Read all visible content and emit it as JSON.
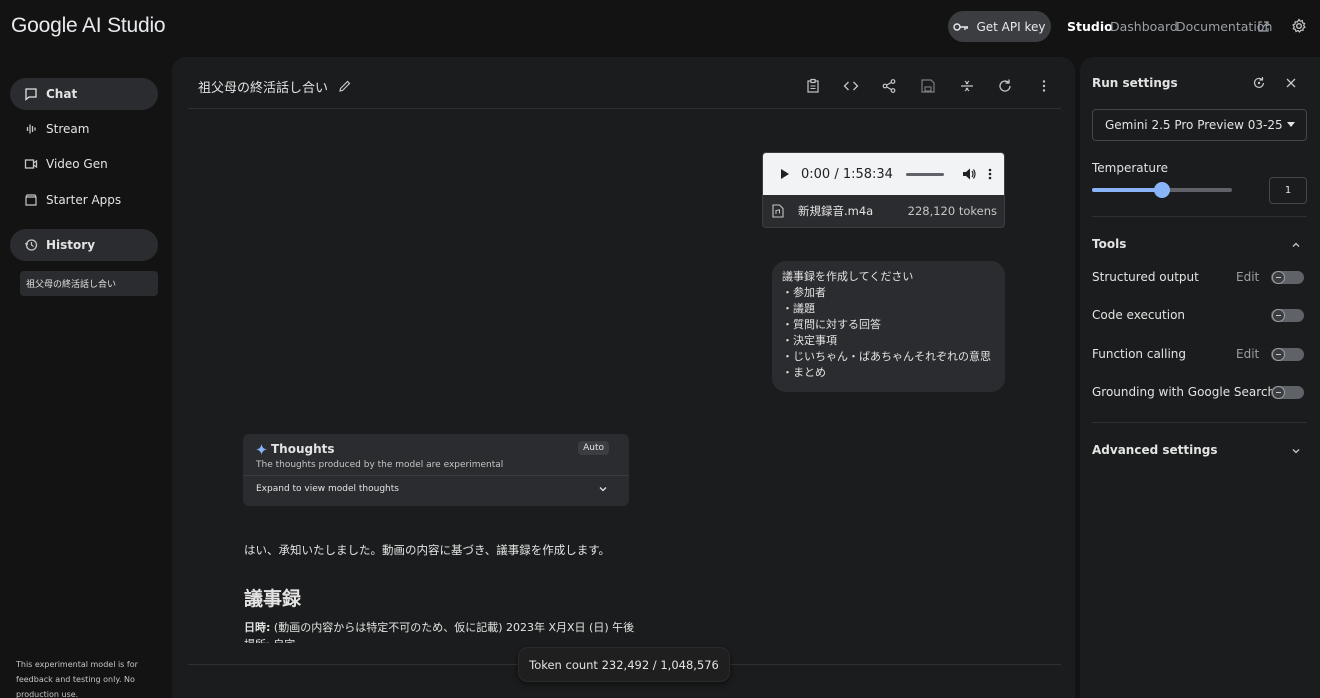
{
  "app": {
    "logo": "Google AI Studio"
  },
  "header": {
    "api_key_label": "Get API key",
    "links": {
      "studio": "Studio",
      "dashboard": "Dashboard",
      "documentation": "Documentation"
    },
    "icons": [
      "key-icon",
      "external-link-icon",
      "gear-icon"
    ]
  },
  "sidebar": {
    "items": [
      {
        "label": "Chat",
        "icon": "chat-icon",
        "active": true
      },
      {
        "label": "Stream",
        "icon": "waveform-icon",
        "active": false
      },
      {
        "label": "Video Gen",
        "icon": "video-icon",
        "active": false
      },
      {
        "label": "Starter Apps",
        "icon": "apps-icon",
        "active": false
      }
    ],
    "history": {
      "label": "History",
      "icon": "history-icon"
    },
    "history_items": [
      "祖父母の終活話し合い"
    ],
    "disclaimer": "This experimental model is for feedback and testing only. No production use."
  },
  "main": {
    "title": "祖父母の終活話し合い",
    "toolbar_icons": [
      "clipboard-icon",
      "code-icon",
      "share-icon",
      "save-icon",
      "compare-icon",
      "refresh-icon",
      "more-vert-icon"
    ],
    "audio": {
      "time": "0:00 / 1:58:34",
      "progress": 0,
      "file_name": "新規録音.m4a",
      "tokens": "228,120 tokens"
    },
    "user_prompt": [
      "議事録を作成してください",
      "・参加者",
      "・議題",
      "・質問に対する回答",
      "・決定事項",
      "・じいちゃん・ばあちゃんそれぞれの意思",
      "・まとめ"
    ],
    "thoughts": {
      "title": "Thoughts",
      "badge": "Auto",
      "subtitle": "The thoughts produced by the model are experimental",
      "expand_label": "Expand to view model thoughts"
    },
    "reply": "はい、承知いたしました。動画の内容に基づき、議事録を作成します。",
    "minutes_heading": "議事録",
    "date_label": "日時:",
    "date_value": "(動画の内容からは特定不可のため、仮に記載) 2023年 X月X日 (日) 午後",
    "cut_line": "場所: 自宅",
    "token_count": "Token count 232,492 / 1,048,576"
  },
  "run_settings": {
    "title": "Run settings",
    "model": "Gemini 2.5 Pro Preview 03-25",
    "temperature_label": "Temperature",
    "temperature_value": "1",
    "temperature_fraction": 0.5,
    "tools_heading": "Tools",
    "tools": [
      {
        "label": "Structured output",
        "edit": "Edit",
        "enabled": false
      },
      {
        "label": "Code execution",
        "edit": "",
        "enabled": false
      },
      {
        "label": "Function calling",
        "edit": "Edit",
        "enabled": false
      },
      {
        "label": "Grounding with Google Search",
        "edit": "",
        "enabled": false
      }
    ],
    "advanced_heading": "Advanced settings"
  },
  "colors": {
    "background": "#131314",
    "panel": "#1b1c1d",
    "accent": "#8ab4f8"
  }
}
